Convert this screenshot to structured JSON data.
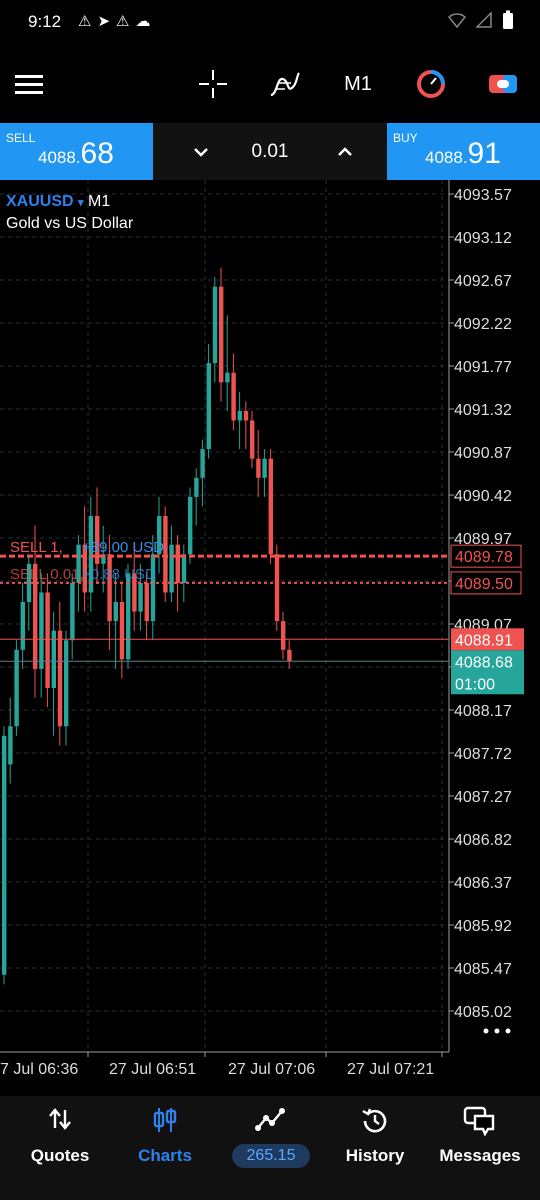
{
  "status_bar": {
    "time": "9:12"
  },
  "toolbar": {
    "timeframe": "M1"
  },
  "trade": {
    "sell_label": "SELL",
    "sell_price_small": "4088.",
    "sell_price_big": "68",
    "quantity": "0.01",
    "buy_label": "BUY",
    "buy_price_small": "4088.",
    "buy_price_big": "91"
  },
  "chart": {
    "symbol": "XAUUSD",
    "timeframe": "M1",
    "description": "Gold vs US Dollar",
    "y_ticks": [
      "4093.57",
      "4093.12",
      "4092.67",
      "4092.22",
      "4091.77",
      "4091.32",
      "4090.87",
      "4090.42",
      "4089.97",
      "4089.52",
      "4089.07",
      "4088.62",
      "4088.17",
      "4087.72",
      "4087.27",
      "4086.82",
      "4086.37",
      "4085.92",
      "4085.47",
      "4085.02"
    ],
    "y_min": 4084.8,
    "y_max": 4093.8,
    "x_ticks": [
      "7 Jul 06:36",
      "27 Jul 06:51",
      "27 Jul 07:06",
      "27 Jul 07:21"
    ],
    "position_lines": [
      {
        "label": "SELL 1,",
        "profit": "+89.00 USD",
        "price": "4089.78",
        "tag": "4089.78"
      },
      {
        "label": "SELL 0.01,",
        "profit": "+0.88 USD",
        "price": "4089.50",
        "tag": "4089.50"
      }
    ],
    "ask_line": {
      "price": "4088.91",
      "tag": "4088.91"
    },
    "bid_line": {
      "price": "4088.68",
      "tag": "4088.68",
      "countdown": "01:00"
    },
    "colors": {
      "bull": "#26a69a",
      "bear": "#ef5350",
      "grid": "#2a2e39",
      "sell_line": "#ef5350"
    },
    "chart_data": {
      "type": "candlestick",
      "candles": [
        {
          "o": 4085.4,
          "h": 4088.0,
          "l": 4085.3,
          "c": 4087.9
        },
        {
          "o": 4087.6,
          "h": 4088.3,
          "l": 4087.4,
          "c": 4088.0
        },
        {
          "o": 4088.0,
          "h": 4088.9,
          "l": 4087.9,
          "c": 4088.8
        },
        {
          "o": 4088.8,
          "h": 4089.5,
          "l": 4088.6,
          "c": 4089.3
        },
        {
          "o": 4089.3,
          "h": 4089.8,
          "l": 4089.0,
          "c": 4089.7
        },
        {
          "o": 4089.7,
          "h": 4090.1,
          "l": 4088.3,
          "c": 4088.6
        },
        {
          "o": 4088.6,
          "h": 4089.6,
          "l": 4088.3,
          "c": 4089.4
        },
        {
          "o": 4089.4,
          "h": 4089.6,
          "l": 4088.2,
          "c": 4088.4
        },
        {
          "o": 4088.4,
          "h": 4089.2,
          "l": 4087.9,
          "c": 4089.0
        },
        {
          "o": 4089.0,
          "h": 4089.3,
          "l": 4087.8,
          "c": 4088.0
        },
        {
          "o": 4088.0,
          "h": 4089.0,
          "l": 4087.8,
          "c": 4088.9
        },
        {
          "o": 4088.9,
          "h": 4089.6,
          "l": 4088.7,
          "c": 4089.5
        },
        {
          "o": 4089.5,
          "h": 4090.0,
          "l": 4089.2,
          "c": 4089.9
        },
        {
          "o": 4089.9,
          "h": 4090.3,
          "l": 4089.2,
          "c": 4089.4
        },
        {
          "o": 4089.4,
          "h": 4090.4,
          "l": 4089.2,
          "c": 4090.2
        },
        {
          "o": 4090.2,
          "h": 4090.5,
          "l": 4089.5,
          "c": 4089.7
        },
        {
          "o": 4089.7,
          "h": 4090.1,
          "l": 4089.4,
          "c": 4089.8
        },
        {
          "o": 4089.8,
          "h": 4090.0,
          "l": 4088.8,
          "c": 4089.1
        },
        {
          "o": 4089.1,
          "h": 4089.6,
          "l": 4088.6,
          "c": 4089.3
        },
        {
          "o": 4089.3,
          "h": 4089.5,
          "l": 4088.5,
          "c": 4088.7
        },
        {
          "o": 4088.7,
          "h": 4089.7,
          "l": 4088.6,
          "c": 4089.6
        },
        {
          "o": 4089.6,
          "h": 4089.9,
          "l": 4089.0,
          "c": 4089.2
        },
        {
          "o": 4089.2,
          "h": 4089.7,
          "l": 4089.0,
          "c": 4089.5
        },
        {
          "o": 4089.5,
          "h": 4089.6,
          "l": 4088.9,
          "c": 4089.1
        },
        {
          "o": 4089.1,
          "h": 4090.0,
          "l": 4088.9,
          "c": 4089.8
        },
        {
          "o": 4089.8,
          "h": 4090.4,
          "l": 4089.6,
          "c": 4090.2
        },
        {
          "o": 4090.2,
          "h": 4090.3,
          "l": 4089.3,
          "c": 4089.4
        },
        {
          "o": 4089.4,
          "h": 4090.1,
          "l": 4089.3,
          "c": 4089.9
        },
        {
          "o": 4089.9,
          "h": 4090.0,
          "l": 4089.2,
          "c": 4089.5
        },
        {
          "o": 4089.5,
          "h": 4089.9,
          "l": 4089.3,
          "c": 4089.8
        },
        {
          "o": 4089.8,
          "h": 4090.5,
          "l": 4089.7,
          "c": 4090.4
        },
        {
          "o": 4090.4,
          "h": 4090.7,
          "l": 4090.1,
          "c": 4090.6
        },
        {
          "o": 4090.6,
          "h": 4091.0,
          "l": 4090.3,
          "c": 4090.9
        },
        {
          "o": 4090.9,
          "h": 4092.0,
          "l": 4090.8,
          "c": 4091.8
        },
        {
          "o": 4091.8,
          "h": 4092.7,
          "l": 4091.6,
          "c": 4092.6
        },
        {
          "o": 4092.6,
          "h": 4092.8,
          "l": 4091.4,
          "c": 4091.6
        },
        {
          "o": 4091.6,
          "h": 4092.3,
          "l": 4091.3,
          "c": 4091.7
        },
        {
          "o": 4091.7,
          "h": 4091.9,
          "l": 4091.1,
          "c": 4091.2
        },
        {
          "o": 4091.2,
          "h": 4091.5,
          "l": 4090.9,
          "c": 4091.3
        },
        {
          "o": 4091.3,
          "h": 4091.4,
          "l": 4090.9,
          "c": 4091.2
        },
        {
          "o": 4091.2,
          "h": 4091.3,
          "l": 4090.7,
          "c": 4090.8
        },
        {
          "o": 4090.8,
          "h": 4091.1,
          "l": 4090.4,
          "c": 4090.6
        },
        {
          "o": 4090.6,
          "h": 4090.9,
          "l": 4090.4,
          "c": 4090.8
        },
        {
          "o": 4090.8,
          "h": 4090.9,
          "l": 4089.7,
          "c": 4089.8
        },
        {
          "o": 4089.8,
          "h": 4089.9,
          "l": 4089.0,
          "c": 4089.1
        },
        {
          "o": 4089.1,
          "h": 4089.2,
          "l": 4088.7,
          "c": 4088.8
        },
        {
          "o": 4088.8,
          "h": 4088.9,
          "l": 4088.6,
          "c": 4088.68
        }
      ]
    }
  },
  "nav": {
    "quotes": "Quotes",
    "charts": "Charts",
    "trade_pnl": "265.15",
    "history": "History",
    "messages": "Messages"
  }
}
